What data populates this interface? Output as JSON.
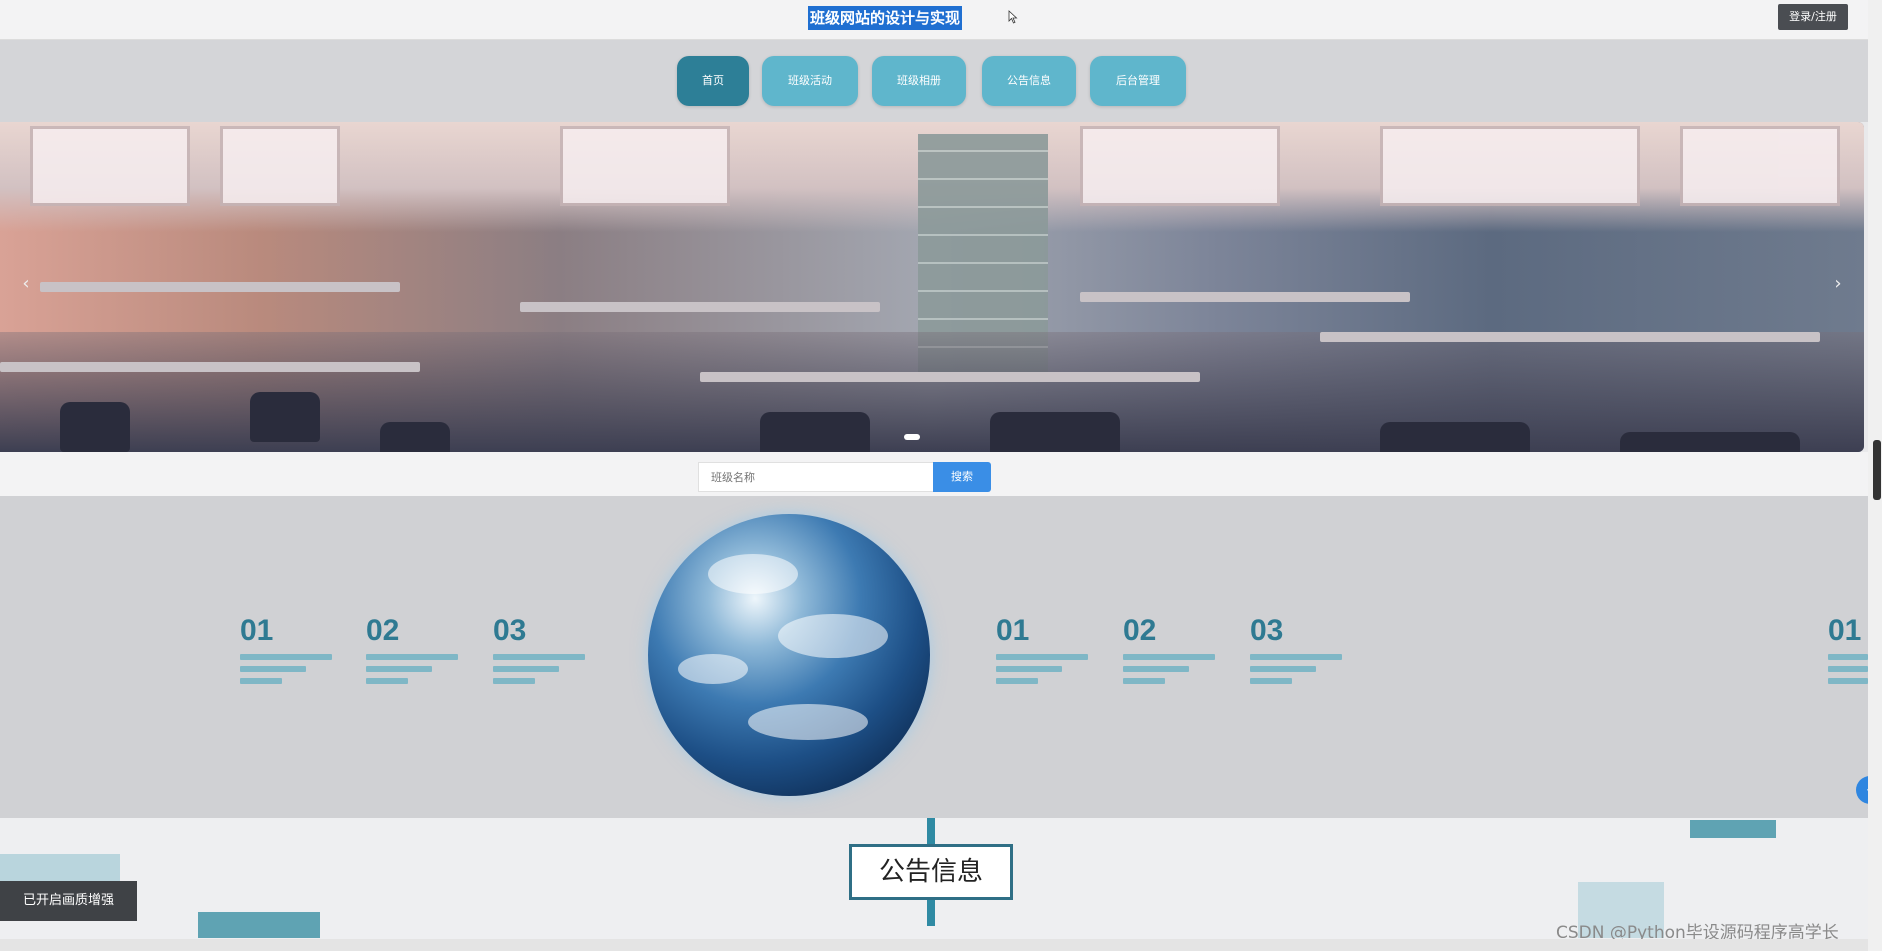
{
  "header": {
    "site_title": "班级网站的设计与实现",
    "login_label": "登录/注册"
  },
  "nav": {
    "items": [
      {
        "label": "首页",
        "active": true
      },
      {
        "label": "班级活动",
        "active": false
      },
      {
        "label": "班级相册",
        "active": false
      },
      {
        "label": "公告信息",
        "active": false
      },
      {
        "label": "后台管理",
        "active": false
      }
    ]
  },
  "banner": {
    "prev_icon": "chevron-left-icon",
    "next_icon": "chevron-right-icon",
    "prev_glyph": "‹",
    "next_glyph": "›"
  },
  "search": {
    "placeholder": "班级名称",
    "button_label": "搜索"
  },
  "stats": {
    "left": [
      "01",
      "02",
      "03"
    ],
    "right": [
      "01",
      "02",
      "03"
    ],
    "edge": "01"
  },
  "notice": {
    "title": "公告信息"
  },
  "overlay": {
    "quality_label": "已开启画质增强",
    "watermark": "CSDN @Python毕设源码程序高学长",
    "side_toggle_glyph": "‹"
  },
  "colors": {
    "accent": "#2f7a92",
    "nav_active": "#2d7f97",
    "nav_default": "#5fb6cc",
    "search_button": "#3a8ee6",
    "title_highlight": "#1f6fd1"
  }
}
